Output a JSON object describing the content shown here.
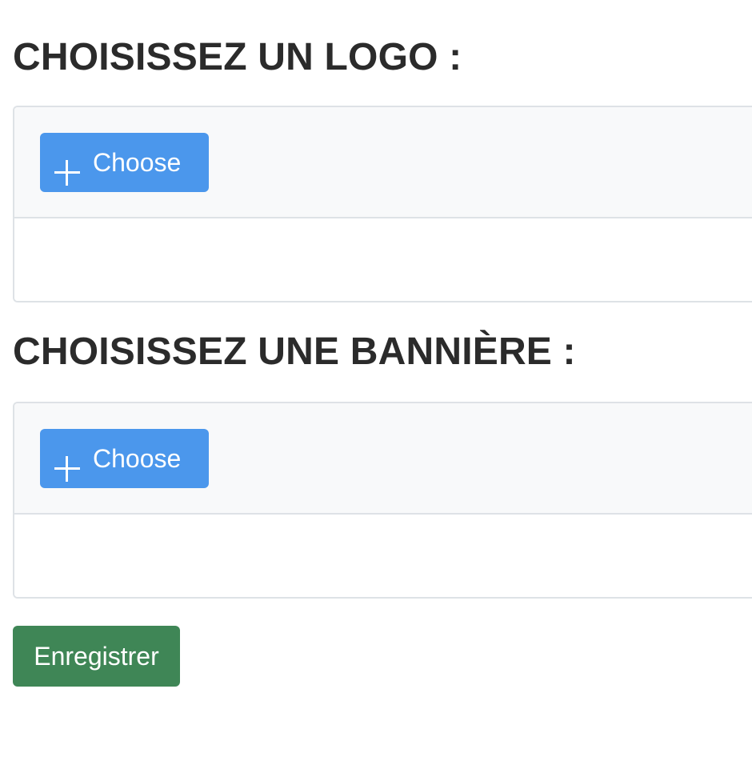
{
  "logo_section": {
    "title": "CHOISISSEZ UN LOGO :",
    "choose_label": "Choose"
  },
  "banner_section": {
    "title": "CHOISISSEZ UNE BANNIÈRE :",
    "choose_label": "Choose"
  },
  "save_label": "Enregistrer",
  "icons": {
    "choose": "plus-icon"
  },
  "colors": {
    "choose_button": "#4b97ec",
    "save_button": "#3f8656",
    "heading": "#2b2b2b",
    "toolbar_bg": "#f8f9fa",
    "border": "#dee2e6"
  }
}
